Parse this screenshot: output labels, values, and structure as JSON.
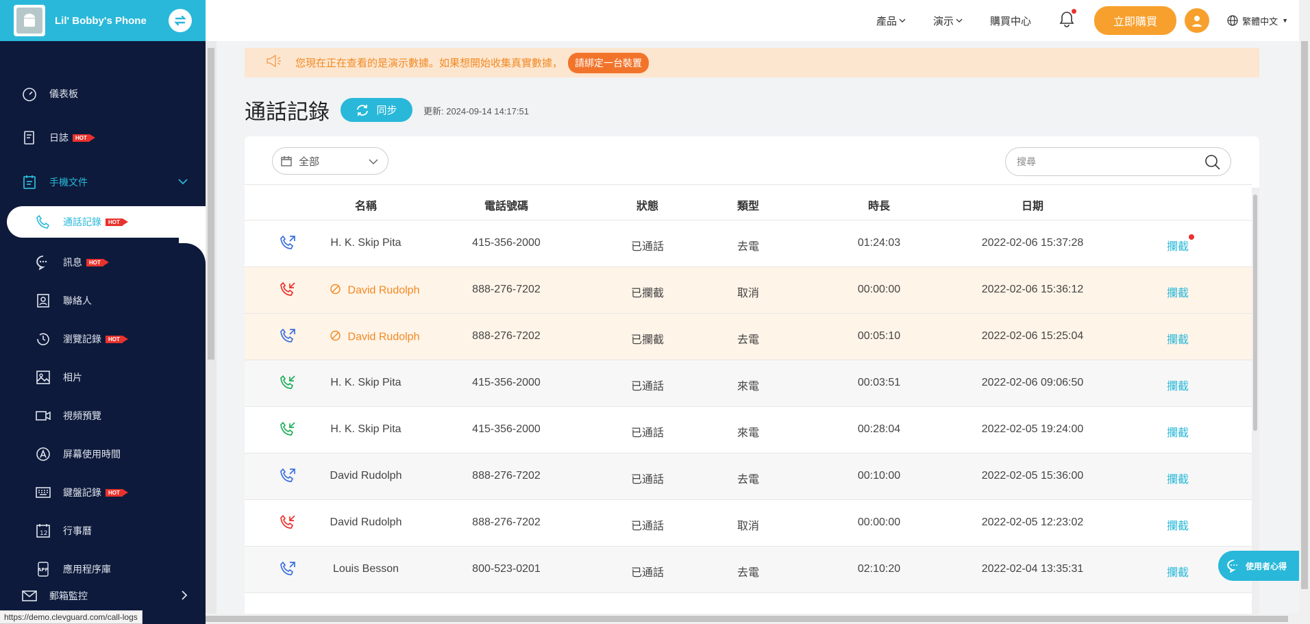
{
  "device_name": "Lil' Bobby's Phone",
  "sidebar": {
    "items": [
      {
        "label": "儀表板",
        "icon": "dashboard-icon"
      },
      {
        "label": "日誌",
        "icon": "log-icon",
        "hot": "HOT"
      },
      {
        "label": "手機文件",
        "icon": "phone-files-icon"
      },
      {
        "label": "通話記錄",
        "icon": "phone-icon",
        "hot": "HOT"
      },
      {
        "label": "訊息",
        "icon": "message-icon",
        "hot": "HOT"
      },
      {
        "label": "聯絡人",
        "icon": "contacts-icon"
      },
      {
        "label": "瀏覽記錄",
        "icon": "history-icon",
        "hot": "HOT"
      },
      {
        "label": "相片",
        "icon": "photo-icon"
      },
      {
        "label": "視頻預覽",
        "icon": "video-icon"
      },
      {
        "label": "屏幕使用時間",
        "icon": "screen-time-icon"
      },
      {
        "label": "鍵盤記錄",
        "icon": "keyboard-icon",
        "hot": "HOT"
      },
      {
        "label": "行事曆",
        "icon": "calendar-icon"
      },
      {
        "label": "應用程序庫",
        "icon": "app-icon"
      },
      {
        "label": "郵箱監控",
        "icon": "mail-icon"
      }
    ]
  },
  "topbar": {
    "products": "產品",
    "demo": "演示",
    "buy_center": "購買中心",
    "buy_now": "立即購買",
    "language": "繁體中文"
  },
  "notice": {
    "text": "您現在正在查看的是演示數據。如果想開始收集真實數據，",
    "button": "請綁定一台裝置"
  },
  "page": {
    "title": "通話記錄",
    "sync_label": "同步",
    "updated": "更新:  2024-09-14 14:17:51"
  },
  "filter": {
    "label": "全部"
  },
  "search": {
    "placeholder": "搜尋"
  },
  "table": {
    "columns": [
      "名稱",
      "電話號碼",
      "狀態",
      "類型",
      "時長",
      "日期"
    ],
    "rows": [
      {
        "dir": "outgoing",
        "name": "H. K. Skip Pita",
        "phone": "415-356-2000",
        "status": "已通話",
        "type": "去電",
        "duration": "01:24:03",
        "date": "2022-02-06 15:37:28",
        "action": "攔截",
        "blocked": false,
        "dot": true
      },
      {
        "dir": "cancelled",
        "name": "David Rudolph",
        "phone": "888-276-7202",
        "status": "已攔截",
        "type": "取消",
        "duration": "00:00:00",
        "date": "2022-02-06 15:36:12",
        "action": "攔截",
        "blocked": true
      },
      {
        "dir": "outgoing",
        "name": "David Rudolph",
        "phone": "888-276-7202",
        "status": "已攔截",
        "type": "去電",
        "duration": "00:05:10",
        "date": "2022-02-06 15:25:04",
        "action": "攔截",
        "blocked": true
      },
      {
        "dir": "incoming",
        "name": "H. K. Skip Pita",
        "phone": "415-356-2000",
        "status": "已通話",
        "type": "來電",
        "duration": "00:03:51",
        "date": "2022-02-06 09:06:50",
        "action": "攔截",
        "blocked": false,
        "alt": true
      },
      {
        "dir": "incoming",
        "name": "H. K. Skip Pita",
        "phone": "415-356-2000",
        "status": "已通話",
        "type": "來電",
        "duration": "00:28:04",
        "date": "2022-02-05 19:24:00",
        "action": "攔截",
        "blocked": false
      },
      {
        "dir": "outgoing",
        "name": "David Rudolph",
        "phone": "888-276-7202",
        "status": "已通話",
        "type": "去電",
        "duration": "00:10:00",
        "date": "2022-02-05 15:36:00",
        "action": "攔截",
        "blocked": false,
        "alt": true
      },
      {
        "dir": "cancelled",
        "name": "David Rudolph",
        "phone": "888-276-7202",
        "status": "已通話",
        "type": "取消",
        "duration": "00:00:00",
        "date": "2022-02-05 12:23:02",
        "action": "攔截",
        "blocked": false
      },
      {
        "dir": "outgoing",
        "name": "Louis Besson",
        "phone": "800-523-0201",
        "status": "已通話",
        "type": "去電",
        "duration": "02:10:20",
        "date": "2022-02-04 13:35:31",
        "action": "攔截",
        "blocked": false,
        "alt": true
      }
    ]
  },
  "chat_label": "使用者心得",
  "status_url": "https://demo.clevguard.com/call-logs",
  "colors": {
    "accent": "#29b8d9",
    "sidebar": "#0e1a3b",
    "orange": "#f7a02d",
    "blocked_bg": "#fff4e8"
  }
}
